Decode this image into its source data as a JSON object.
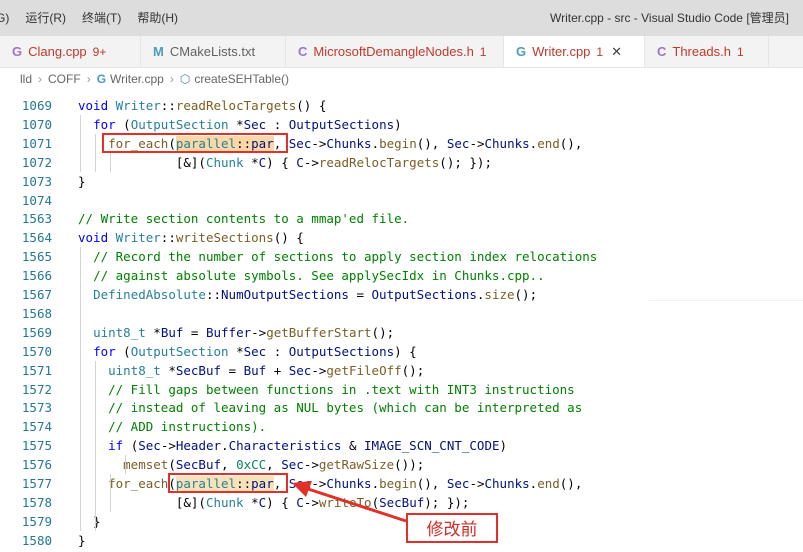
{
  "menu": [
    "G)",
    "运行(R)",
    "终端(T)",
    "帮助(H)"
  ],
  "window_title": "Writer.cpp - src - Visual Studio Code [管理员]",
  "tabs": [
    {
      "icon": "G",
      "label": "Clang.cpp",
      "count": "9+",
      "color": "#a074c4",
      "active": false
    },
    {
      "icon": "M",
      "label": "CMakeLists.txt",
      "count": "",
      "color": "#519aba",
      "active": false
    },
    {
      "icon": "C",
      "label": "MicrosoftDemangleNodes.h",
      "count": "1",
      "color": "#a074c4",
      "active": false
    },
    {
      "icon": "G",
      "label": "Writer.cpp",
      "count": "1",
      "color": "#519aba",
      "active": true
    },
    {
      "icon": "C",
      "label": "Threads.h",
      "count": "1",
      "color": "#a074c4",
      "active": false
    }
  ],
  "breadcrumb": [
    "lld",
    "COFF",
    "Writer.cpp",
    "createSEHTable()"
  ],
  "code_lines": [
    {
      "n": "1069",
      "html": "<span class=\"kw\">void</span> <span class=\"ty\">Writer</span>::<span class=\"fn\">readRelocTargets</span>() {"
    },
    {
      "n": "1070",
      "html": "  <span class=\"kw\">for</span> (<span class=\"ty\">OutputSection</span> *<span class=\"var\">Sec</span> : <span class=\"var\">OutputSections</span>)"
    },
    {
      "n": "1071",
      "html": "    <span class=\"fn\">for_each</span>(<span class=\"hl-sel\"><span class=\"ty\">parallel</span>::<span class=\"var\">par</span></span>, <span class=\"var\">Sec</span>-><span class=\"var\">Chunks</span>.<span class=\"fn\">begin</span>(), <span class=\"var\">Sec</span>-><span class=\"var\">Chunks</span>.<span class=\"fn\">end</span>(),"
    },
    {
      "n": "1072",
      "html": "             [&](<span class=\"ty\">Chunk</span> *<span class=\"var\">C</span>) { <span class=\"var\">C</span>-><span class=\"fn\">readRelocTargets</span>(); });"
    },
    {
      "n": "1073",
      "html": "}"
    },
    {
      "n": "1074",
      "html": ""
    },
    {
      "n": "1563",
      "html": "<span class=\"cm\">// Write section contents to a mmap'ed file.</span>"
    },
    {
      "n": "1564",
      "html": "<span class=\"kw\">void</span> <span class=\"ty\">Writer</span>::<span class=\"fn\">writeSections</span>() {"
    },
    {
      "n": "1565",
      "html": "  <span class=\"cm\">// Record the number of sections to apply section index relocations</span>"
    },
    {
      "n": "1566",
      "html": "  <span class=\"cm\">// against absolute symbols. See applySecIdx in Chunks.cpp..</span>"
    },
    {
      "n": "1567",
      "html": "  <span class=\"ty\">DefinedAbsolute</span>::<span class=\"var\">NumOutputSections</span> = <span class=\"var\">OutputSections</span>.<span class=\"fn\">size</span>();"
    },
    {
      "n": "1568",
      "html": ""
    },
    {
      "n": "1569",
      "html": "  <span class=\"ty\">uint8_t</span> *<span class=\"var\">Buf</span> = <span class=\"var\">Buffer</span>-><span class=\"fn\">getBufferStart</span>();"
    },
    {
      "n": "1570",
      "html": "  <span class=\"kw\">for</span> (<span class=\"ty\">OutputSection</span> *<span class=\"var\">Sec</span> : <span class=\"var\">OutputSections</span>) {"
    },
    {
      "n": "1571",
      "html": "    <span class=\"ty\">uint8_t</span> *<span class=\"var\">SecBuf</span> = <span class=\"var\">Buf</span> + <span class=\"var\">Sec</span>-><span class=\"fn\">getFileOff</span>();"
    },
    {
      "n": "1572",
      "html": "    <span class=\"cm\">// Fill gaps between functions in .text with INT3 instructions</span>"
    },
    {
      "n": "1573",
      "html": "    <span class=\"cm\">// instead of leaving as NUL bytes (which can be interpreted as</span>"
    },
    {
      "n": "1574",
      "html": "    <span class=\"cm\">// ADD instructions).</span>"
    },
    {
      "n": "1575",
      "html": "    <span class=\"kw\">if</span> (<span class=\"var\">Sec</span>-><span class=\"var\">Header</span>.<span class=\"var\">Characteristics</span> & <span class=\"var\">IMAGE_SCN_CNT_CODE</span>)"
    },
    {
      "n": "1576",
      "html": "      <span class=\"fn\">memset</span>(<span class=\"var\">SecBuf</span>, <span class=\"num\">0xCC</span>, <span class=\"var\">Sec</span>-><span class=\"fn\">getRawSize</span>());"
    },
    {
      "n": "1577",
      "html": "    <span class=\"fn\">for_each</span>(<span class=\"hl-sel2\"><span class=\"ty\">parallel</span>::<span class=\"var\">par</span></span>, <span class=\"var\">Sec</span>-><span class=\"var\">Chunks</span>.<span class=\"fn\">begin</span>(), <span class=\"var\">Sec</span>-><span class=\"var\">Chunks</span>.<span class=\"fn\">end</span>(),"
    },
    {
      "n": "1578",
      "html": "             [&](<span class=\"ty\">Chunk</span> *<span class=\"var\">C</span>) { <span class=\"var\">C</span>-><span class=\"fn\">writeTo</span>(<span class=\"var\">SecBuf</span>); });"
    },
    {
      "n": "1579",
      "html": "  }"
    },
    {
      "n": "1580",
      "html": "}"
    }
  ],
  "annotation": "修改前",
  "colors": {
    "highlight_box": "#e0302a",
    "accent": "#0000ff"
  }
}
